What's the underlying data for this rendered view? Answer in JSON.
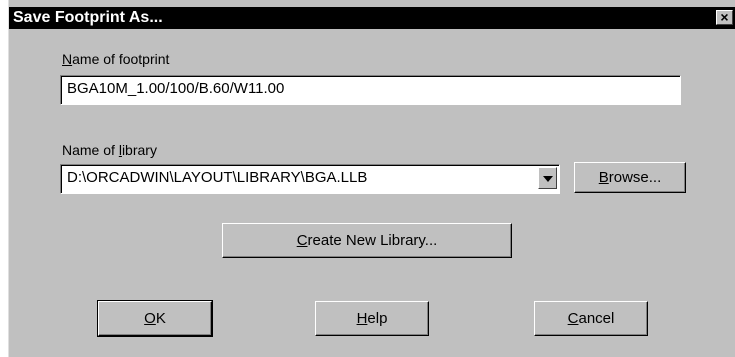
{
  "dialog": {
    "title": "Save Footprint As...",
    "close_glyph": "×"
  },
  "footprint": {
    "label_mnemonic": "N",
    "label_rest": "ame of footprint",
    "value": "BGA10M_1.00/100/B.60/W11.00"
  },
  "library": {
    "label_prefix": "Name of ",
    "label_mnemonic": "l",
    "label_rest": "ibrary",
    "value": "D:\\ORCADWIN\\LAYOUT\\LIBRARY\\BGA.LLB"
  },
  "buttons": {
    "browse": {
      "mnemonic": "B",
      "rest": "rowse..."
    },
    "create": {
      "mnemonic": "C",
      "rest": "reate New Library..."
    },
    "ok": {
      "mnemonic": "O",
      "rest": "K"
    },
    "help": {
      "mnemonic": "H",
      "rest": "elp"
    },
    "cancel": {
      "mnemonic": "C",
      "rest": "ancel"
    }
  },
  "icons": {
    "close": "close-icon",
    "dropdown": "chevron-down-icon"
  }
}
